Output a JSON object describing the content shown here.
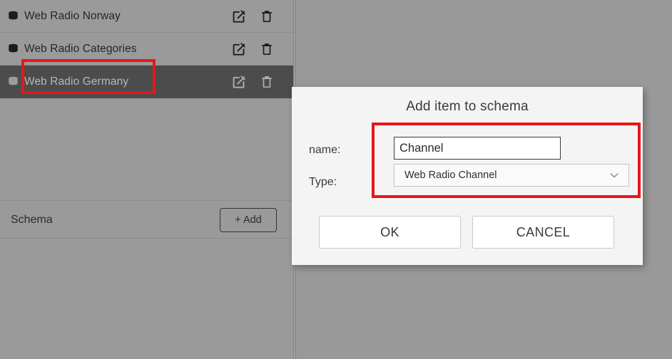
{
  "colors": {
    "panel_bg": "#9a9a9a",
    "content_bg": "#999999",
    "selected_row_bg": "#4c4c4c",
    "dialog_bg": "#f4f4f4",
    "highlight_red": "#e8161a",
    "text_dark": "#262626",
    "selected_text": "#b7b7b7"
  },
  "sidebar": {
    "rows": [
      {
        "label": "Web Radio Norway",
        "icon": "database-icon",
        "edit_icon": "edit-icon",
        "delete_icon": "trash-icon",
        "selected": false
      },
      {
        "label": "Web Radio Categories",
        "icon": "database-icon",
        "edit_icon": "edit-icon",
        "delete_icon": "trash-icon",
        "selected": false
      },
      {
        "label": "Web Radio Germany",
        "icon": "database-icon",
        "edit_icon": "edit-icon",
        "delete_icon": "trash-icon",
        "selected": true
      }
    ],
    "schema_bar": {
      "title": "Schema",
      "add_button_label": "+ Add"
    }
  },
  "dialog": {
    "title": "Add item to schema",
    "name_label": "name:",
    "type_label": "Type:",
    "name_value": "Channel",
    "name_placeholder": "",
    "type_value": "Web Radio Channel",
    "type_chevron_icon": "chevron-down-icon",
    "ok_label": "OK",
    "cancel_label": "CANCEL"
  },
  "annotations": {
    "selected_schema_box": "red-highlight-box",
    "dialog_fields_box": "red-highlight-box"
  }
}
